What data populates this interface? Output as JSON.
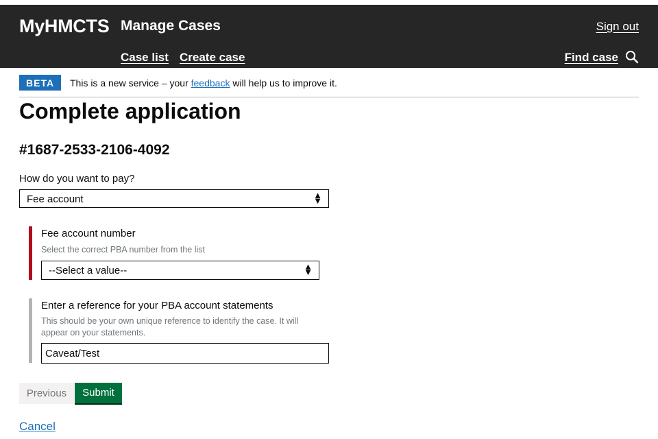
{
  "header": {
    "brand": "MyHMCTS",
    "service": "Manage Cases",
    "sign_out": "Sign out",
    "nav": {
      "case_list": "Case list",
      "create_case": "Create case"
    },
    "find_case": "Find case"
  },
  "phase_banner": {
    "tag": "BETA",
    "text_before": "This is a new service – your",
    "link": "feedback",
    "text_after": "will help us to improve it."
  },
  "page": {
    "title": "Complete application",
    "case_reference": "#1687-2533-2106-4092"
  },
  "form": {
    "payment_method": {
      "label": "How do you want to pay?",
      "value": "Fee account"
    },
    "fee_account": {
      "label": "Fee account number",
      "hint": "Select the correct PBA number from the list",
      "value": "--Select a value--"
    },
    "reference": {
      "label": "Enter a reference for your PBA account statements",
      "hint": "This should be your own unique reference to identify the case. It will appear on your statements.",
      "value": "Caveat/Test"
    },
    "previous_button": "Previous",
    "submit_button": "Submit",
    "cancel_link": "Cancel"
  },
  "colors": {
    "header_bg": "#262626",
    "beta_tag": "#1d70b8",
    "submit": "#00703c",
    "error_bar": "#b10e1e",
    "link": "#1d70b8"
  },
  "icons": {
    "search": "search-icon",
    "select_arrow": "select-arrows-icon"
  }
}
